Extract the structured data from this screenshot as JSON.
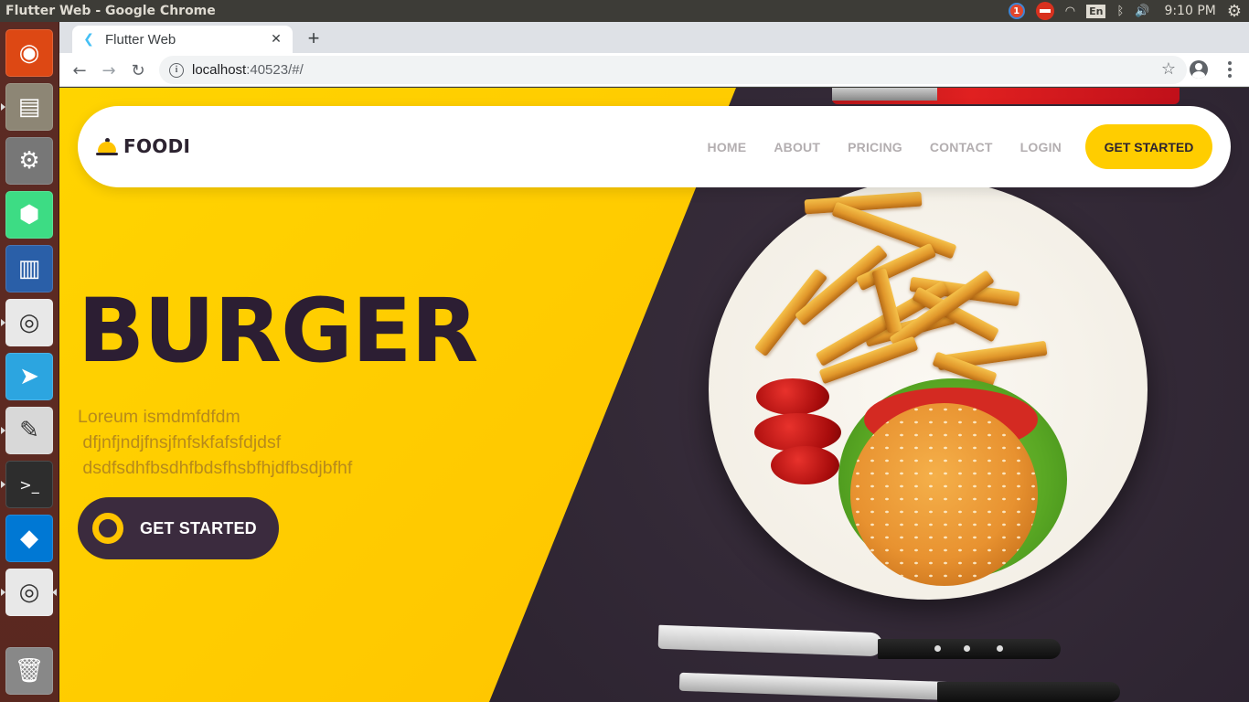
{
  "os": {
    "window_title": "Flutter Web - Google Chrome",
    "tray": {
      "notification_count": "1",
      "keyboard_layout": "En",
      "clock": "9:10 PM"
    },
    "launcher": [
      {
        "name": "ubuntu-dash",
        "color": "#dd4814",
        "glyph": "◉"
      },
      {
        "name": "files",
        "color": "#8d8675",
        "glyph": "▤"
      },
      {
        "name": "system-settings",
        "color": "#777777",
        "glyph": "⚙"
      },
      {
        "name": "android-studio",
        "color": "#3ddc84",
        "glyph": "⬢"
      },
      {
        "name": "libreoffice-writer",
        "color": "#2a5fa8",
        "glyph": "▥"
      },
      {
        "name": "google-chrome",
        "color": "#e8e8e8",
        "glyph": "◎"
      },
      {
        "name": "telegram",
        "color": "#2ca5e0",
        "glyph": "➤"
      },
      {
        "name": "text-editor",
        "color": "#d8d8d8",
        "glyph": "✎"
      },
      {
        "name": "terminal",
        "color": "#2d2d2d",
        "glyph": ">_"
      },
      {
        "name": "visual-studio-code",
        "color": "#0078d4",
        "glyph": "◆"
      },
      {
        "name": "google-chrome-2",
        "color": "#e8e8e8",
        "glyph": "◎"
      },
      {
        "name": "trash",
        "color": "#888888",
        "glyph": "🗑"
      }
    ]
  },
  "browser": {
    "tab_title": "Flutter Web",
    "url_host": "localhost",
    "url_rest": ":40523/#/",
    "new_tab_label": "+"
  },
  "site": {
    "brand": "FOODI",
    "nav": [
      "HOME",
      "ABOUT",
      "PRICING",
      "CONTACT",
      "LOGIN"
    ],
    "nav_cta": "GET STARTED",
    "hero_title": "BURGER",
    "hero_description": "Loreum ismdmfdfdm\n dfjnfjndjfnsjfnfskfafsfdjdsf\n dsdfsdhfbsdhfbdsfhsbfhjdfbsdjbfhf",
    "hero_cta": "GET STARTED",
    "colors": {
      "accent_yellow": "#ffcd00",
      "dark": "#2c2330",
      "nav_link_grey": "#b3aeb0"
    }
  }
}
